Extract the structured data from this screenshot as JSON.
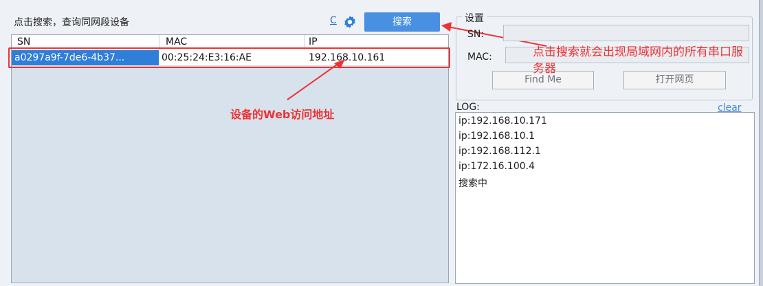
{
  "left_panel": {
    "title": "点击搜索，查询同网段设备",
    "refresh_link": "C",
    "search_button": "搜索"
  },
  "table": {
    "columns": [
      "SN",
      "MAC",
      "IP"
    ],
    "rows": [
      {
        "sn": "a0297a9f-7de6-4b37...",
        "mac": "00:25:24:E3:16:AE",
        "ip": "192.168.10.161"
      }
    ]
  },
  "settings": {
    "legend": "设置",
    "sn_label": "SN:",
    "mac_label": "MAC:",
    "find_me": "Find Me",
    "open_page": "打开网页"
  },
  "log": {
    "label": "LOG:",
    "clear": "clear",
    "lines": [
      "ip:192.168.10.171",
      "ip:192.168.10.1",
      "ip:192.168.112.1",
      "ip:172.16.100.4",
      "搜索中"
    ]
  },
  "annotations": {
    "web_address": "设备的Web访问地址",
    "search_result": "点击搜索就会出现局域网内的所有串口服务器"
  },
  "colors": {
    "accent": "#4a90e2",
    "annotation": "#e33333",
    "selected_row": "#2f7ed8"
  }
}
